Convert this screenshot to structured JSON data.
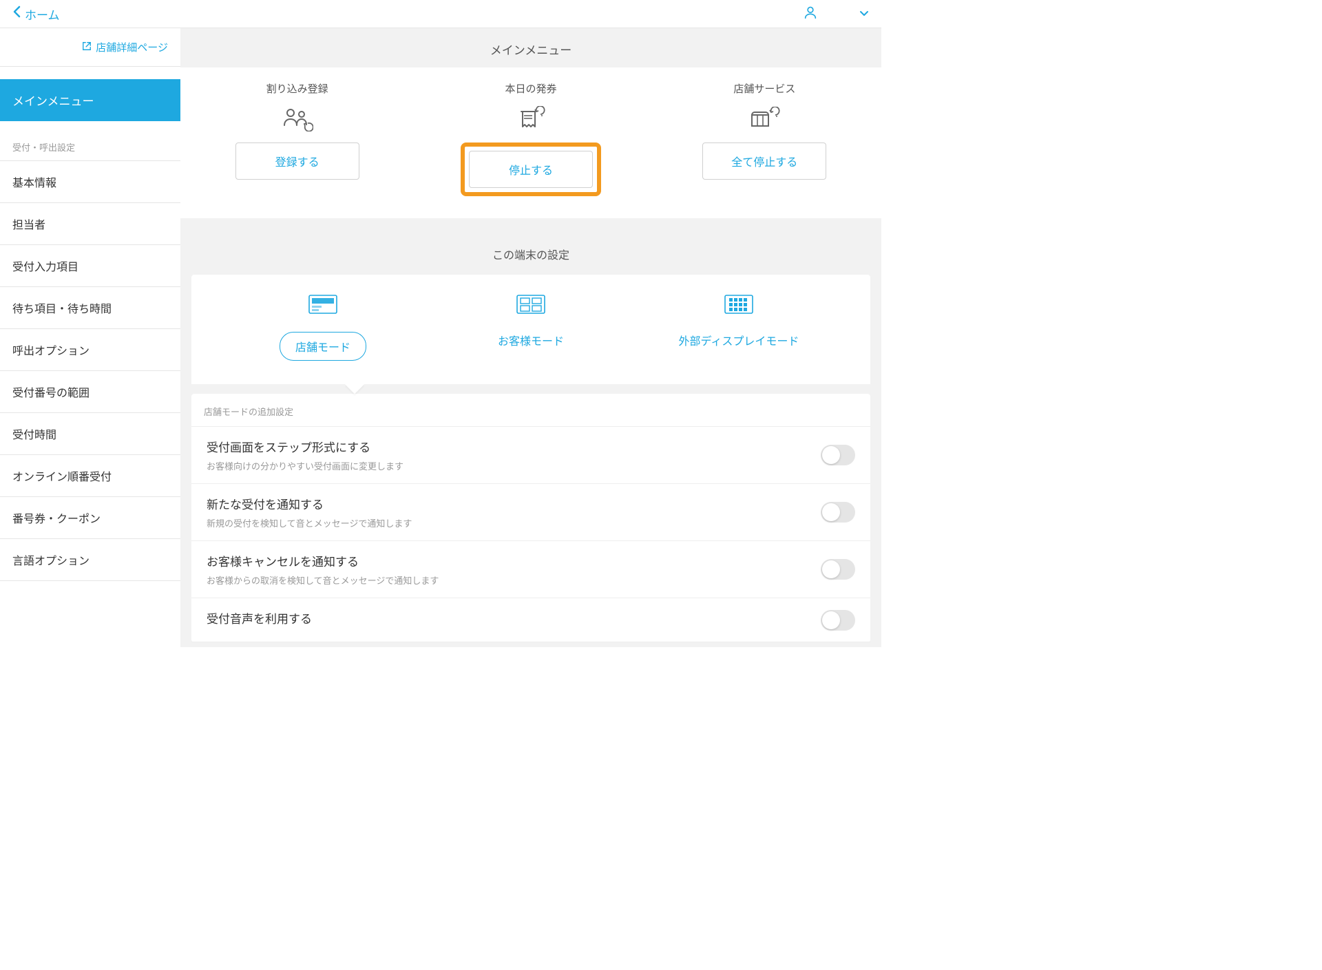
{
  "topbar": {
    "home_label": "ホーム"
  },
  "sidebar": {
    "store_detail_link": "店舗詳細ページ",
    "main_menu_label": "メインメニュー",
    "section_header": "受付・呼出設定",
    "items": [
      "基本情報",
      "担当者",
      "受付入力項目",
      "待ち項目・待ち時間",
      "呼出オプション",
      "受付番号の範囲",
      "受付時間",
      "オンライン順番受付",
      "番号券・クーポン",
      "言語オプション"
    ]
  },
  "main_menu": {
    "title": "メインメニュー",
    "cols": [
      {
        "title": "割り込み登録",
        "button": "登録する"
      },
      {
        "title": "本日の発券",
        "button": "停止する"
      },
      {
        "title": "店舗サービス",
        "button": "全て停止する"
      }
    ]
  },
  "device": {
    "title": "この端末の設定",
    "modes": [
      "店舗モード",
      "お客様モード",
      "外部ディスプレイモード"
    ],
    "settings_header": "店舗モードの追加設定",
    "settings": [
      {
        "title": "受付画面をステップ形式にする",
        "desc": "お客様向けの分かりやすい受付画面に変更します"
      },
      {
        "title": "新たな受付を通知する",
        "desc": "新規の受付を検知して音とメッセージで通知します"
      },
      {
        "title": "お客様キャンセルを通知する",
        "desc": "お客様からの取消を検知して音とメッセージで通知します"
      },
      {
        "title": "受付音声を利用する",
        "desc": ""
      }
    ]
  }
}
